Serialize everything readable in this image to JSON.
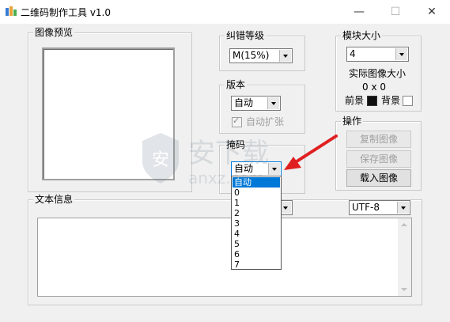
{
  "window": {
    "title": "二维码制作工具 v1.0",
    "min_glyph": "—",
    "max_glyph": "☐",
    "close_glyph": "✕"
  },
  "preview": {
    "legend": "图像预览"
  },
  "ecc": {
    "legend": "纠错等级",
    "value": "M(15%)"
  },
  "version": {
    "legend": "版本",
    "value": "自动",
    "auto_extend_label": "自动扩张",
    "auto_extend_checked": true
  },
  "mask": {
    "legend": "掩码",
    "value": "自动",
    "options": [
      "自动",
      "0",
      "1",
      "2",
      "3",
      "4",
      "5",
      "6",
      "7"
    ],
    "selected_index": 0
  },
  "module": {
    "legend": "模块大小",
    "value": "4",
    "actual_label": "实际图像大小",
    "actual_value": "0 x 0",
    "fg_label": "前景",
    "bg_label": "背景",
    "fg_color": "#111111",
    "bg_color": "#ffffff"
  },
  "ops": {
    "legend": "操作",
    "copy": "复制图像",
    "save": "保存图像",
    "load": "载入图像"
  },
  "text": {
    "legend": "文本信息",
    "encoding": "UTF-8"
  },
  "watermark": {
    "text": "安下载",
    "sub": "anxz.com"
  }
}
